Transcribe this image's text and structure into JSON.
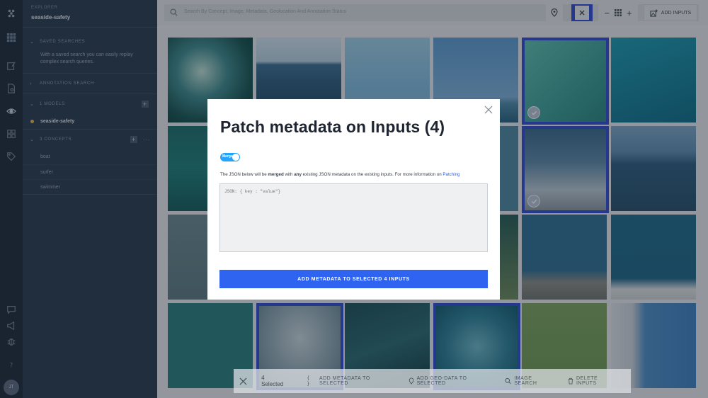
{
  "explorer": {
    "section_label": "EXPLORER",
    "app_name": "seaside-safety"
  },
  "sidebar": {
    "saved_searches": {
      "label": "SAVED SEARCHES",
      "description": "With a saved search you can easily replay complex search queries."
    },
    "annotation_search": {
      "label": "ANNOTATION SEARCH"
    },
    "models": {
      "label": "1 MODELS",
      "items": [
        {
          "label": "seaside-safety"
        }
      ]
    },
    "concepts": {
      "label": "3 CONCEPTS",
      "items": [
        {
          "label": "boat"
        },
        {
          "label": "surfer"
        },
        {
          "label": "swimmer"
        }
      ]
    },
    "user_initials": "JT"
  },
  "topbar": {
    "search_placeholder": "Search By Concept, Image, Metadata, Geolocation And Annotation Status",
    "add_inputs_label": "ADD INPUTS"
  },
  "modal": {
    "title": "Patch metadata on Inputs (4)",
    "toggle_label": "Merge",
    "help_prefix": "The JSON below will be ",
    "help_bold1": "merged",
    "help_mid": " with ",
    "help_bold2": "any",
    "help_suffix": " existing JSON metadata on the existing inputs. For more information on ",
    "help_link": "Patching",
    "json_placeholder": "JSON: { key : \"value\"}",
    "submit_label": "ADD METADATA TO SELECTED 4 INPUTS"
  },
  "action_bar": {
    "selected_count": "4 Selected",
    "add_metadata": "ADD METADATA TO SELECTED",
    "add_geo": "ADD GEO-DATA TO SELECTED",
    "image_search": "IMAGE SEARCH",
    "delete_inputs": "DELETE INPUTS"
  },
  "colors": {
    "selection_border": "#2f4bd3",
    "primary_button": "#2f64f0",
    "toggle_on": "#23a4ff",
    "sidebar_bg": "#2b3b4e"
  }
}
